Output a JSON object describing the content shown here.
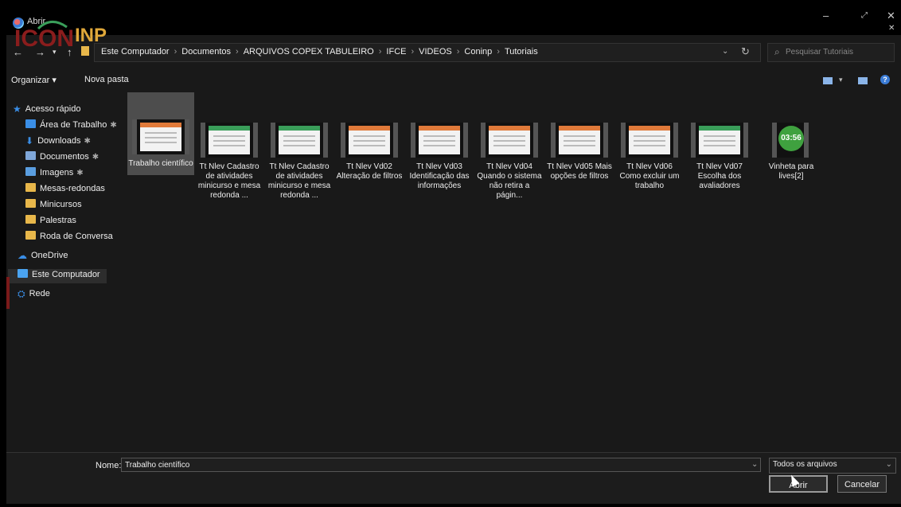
{
  "window": {
    "title": "Abrir",
    "controls": {
      "minimize": "–",
      "maximize": "⤢",
      "close": "✕",
      "close2": "✕"
    }
  },
  "overlay_logo": "ICONINP",
  "nav": {
    "back": "←",
    "forward": "→",
    "recent": "▾",
    "up": "↑"
  },
  "breadcrumbs": [
    "Este Computador",
    "Documentos",
    "ARQUIVOS COPEX TABULEIRO",
    "IFCE",
    "VIDEOS",
    "Coninp",
    "Tutoriais"
  ],
  "breadcrumb_sep": "›",
  "address_dropdown": "⌄",
  "refresh": "↻",
  "search": {
    "icon": "⌕",
    "placeholder": "Pesquisar Tutoriais"
  },
  "commands": {
    "organize": "Organizar ▾",
    "new_folder": "Nova pasta"
  },
  "view_controls": {
    "dropdown": "▾",
    "help": "?"
  },
  "sidebar": [
    {
      "label": "Acesso rápido",
      "icon": "star-icon",
      "pinned": false
    },
    {
      "label": "Área de Trabalho",
      "icon": "desktop-icon",
      "pinned": true
    },
    {
      "label": "Downloads",
      "icon": "download-icon",
      "pinned": true
    },
    {
      "label": "Documentos",
      "icon": "document-icon",
      "pinned": true
    },
    {
      "label": "Imagens",
      "icon": "image-icon",
      "pinned": true
    },
    {
      "label": "Mesas-redondas",
      "icon": "folder-icon",
      "pinned": false
    },
    {
      "label": "Minicursos",
      "icon": "folder-icon",
      "pinned": false
    },
    {
      "label": "Palestras",
      "icon": "folder-icon",
      "pinned": false
    },
    {
      "label": "Roda de Conversa",
      "icon": "folder-icon",
      "pinned": false
    },
    {
      "label": "OneDrive",
      "icon": "cloud-icon",
      "pinned": false
    },
    {
      "label": "Este Computador",
      "icon": "computer-icon",
      "pinned": false
    },
    {
      "label": "Rede",
      "icon": "network-icon",
      "pinned": false
    }
  ],
  "pin_glyph": "✱",
  "files": [
    {
      "name": "Trabalho científico",
      "selected": true
    },
    {
      "name": "Tt Nlev Cadastro de atividades minicurso e mesa redonda ...",
      "selected": false
    },
    {
      "name": "Tt Nlev Cadastro de atividades minicurso e mesa redonda ...",
      "selected": false
    },
    {
      "name": "Tt Nlev Vd02 Alteração de filtros",
      "selected": false
    },
    {
      "name": "Tt Nlev Vd03 Identificação das informações",
      "selected": false
    },
    {
      "name": "Tt Nlev Vd04 Quando o sistema não retira a págin...",
      "selected": false
    },
    {
      "name": "Tt Nlev Vd05 Mais opções de filtros",
      "selected": false
    },
    {
      "name": "Tt Nlev Vd06 Como excluir um trabalho",
      "selected": false
    },
    {
      "name": "Tt Nlev Vd07 Escolha dos avaliadores",
      "selected": false
    },
    {
      "name": "Vinheta para lives[2]",
      "selected": false,
      "thumb_text": "03:56"
    }
  ],
  "bottom": {
    "name_label": "Nome:",
    "name_value": "Trabalho científico",
    "name_dropdown": "⌄",
    "filter": "Todos os arquivos",
    "filter_dropdown": "⌄",
    "open_button": "Abrir",
    "cancel_button": "Cancelar"
  },
  "colors": {
    "accent": "#3a8ee6",
    "background": "#191919",
    "selected": "#4d4d4d",
    "folder": "#e8b74a"
  }
}
